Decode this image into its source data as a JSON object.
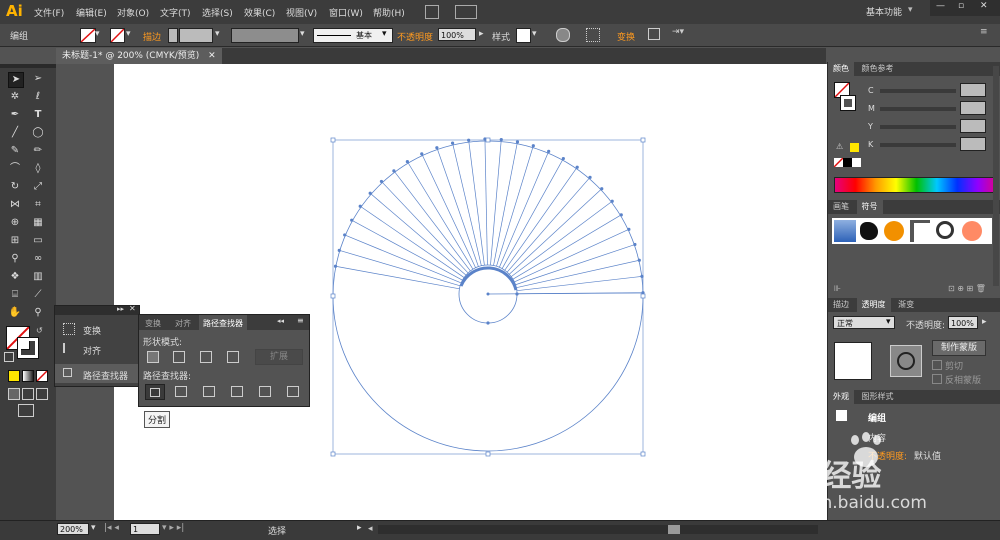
{
  "menubar": {
    "logo": "Ai",
    "items": [
      "文件(F)",
      "编辑(E)",
      "对象(O)",
      "文字(T)",
      "选择(S)",
      "效果(C)",
      "视图(V)",
      "窗口(W)",
      "帮助(H)"
    ],
    "workspace": "基本功能"
  },
  "controlbar": {
    "selection_label": "编组",
    "stroke_label": "描边",
    "brush_label": "基本",
    "opacity_label": "不透明度",
    "opacity_value": "100%",
    "style_label": "样式",
    "transform_label": "变换"
  },
  "document": {
    "tab_label": "未标题-1* @ 200% (CMYK/预览)"
  },
  "float_panel_left": {
    "items": [
      "变换",
      "对齐",
      "路径查找器"
    ]
  },
  "pathfinder_panel": {
    "tabs": [
      "变换",
      "对齐",
      "路径查找器"
    ],
    "shape_modes_label": "形状模式:",
    "expand_label": "扩展",
    "pathfinders_label": "路径查找器:",
    "tooltip": "分割"
  },
  "color_panel": {
    "tabs": [
      "颜色",
      "颜色参考"
    ],
    "channels": [
      "C",
      "M",
      "Y",
      "K"
    ]
  },
  "symbols_panel": {
    "tabs": [
      "画笔",
      "符号"
    ]
  },
  "transparency_panel": {
    "tabs": [
      "描边",
      "透明度",
      "渐变"
    ],
    "blend_mode": "正常",
    "opacity_label": "不透明度:",
    "opacity_value": "100%",
    "make_mask_label": "制作蒙版",
    "clip_label": "剪切",
    "invert_mask_label": "反相蒙版"
  },
  "appearance_panel": {
    "tabs": [
      "外观",
      "图形样式"
    ],
    "group_label": "编组",
    "contents_label": "内容",
    "opacity_label": "不透明度:",
    "opacity_value": "默认值"
  },
  "statusbar": {
    "zoom": "200%",
    "page": "1",
    "tool_status": "选择"
  },
  "watermark": {
    "brand_text": "Bai经验",
    "url": "jingyan.baidu.com"
  },
  "colors": {
    "accent_orange": "#ff9a1f",
    "path_blue": "#5b83c9",
    "panel_bg": "#535353"
  }
}
